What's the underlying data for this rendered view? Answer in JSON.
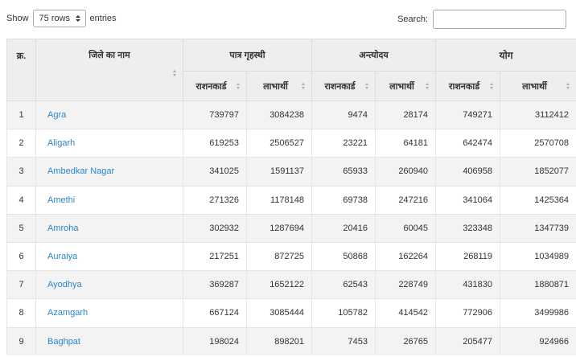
{
  "controls": {
    "show_label": "Show",
    "length_value": "75 rows",
    "entries_label": "entries",
    "search_label": "Search:",
    "search_value": ""
  },
  "table": {
    "headers": {
      "sno": "क्र.",
      "district": "जिले का नाम",
      "group_eligible": "पात्र गृहस्थी",
      "group_antyodaya": "अन्त्योदय",
      "group_total": "योग",
      "sub": [
        "राशनकार्ड",
        "लाभार्थी",
        "राशनकार्ड",
        "लाभार्थी",
        "राशनकार्ड",
        "लाभार्थी"
      ]
    },
    "rows": [
      {
        "sno": "1",
        "district": "Agra",
        "eligible_cards": "739797",
        "eligible_beneficiaries": "3084238",
        "antyodaya_cards": "9474",
        "antyodaya_beneficiaries": "28174",
        "total_cards": "749271",
        "total_beneficiaries": "3112412"
      },
      {
        "sno": "2",
        "district": "Aligarh",
        "eligible_cards": "619253",
        "eligible_beneficiaries": "2506527",
        "antyodaya_cards": "23221",
        "antyodaya_beneficiaries": "64181",
        "total_cards": "642474",
        "total_beneficiaries": "2570708"
      },
      {
        "sno": "3",
        "district": "Ambedkar Nagar",
        "eligible_cards": "341025",
        "eligible_beneficiaries": "1591137",
        "antyodaya_cards": "65933",
        "antyodaya_beneficiaries": "260940",
        "total_cards": "406958",
        "total_beneficiaries": "1852077"
      },
      {
        "sno": "4",
        "district": "Amethi",
        "eligible_cards": "271326",
        "eligible_beneficiaries": "1178148",
        "antyodaya_cards": "69738",
        "antyodaya_beneficiaries": "247216",
        "total_cards": "341064",
        "total_beneficiaries": "1425364"
      },
      {
        "sno": "5",
        "district": "Amroha",
        "eligible_cards": "302932",
        "eligible_beneficiaries": "1287694",
        "antyodaya_cards": "20416",
        "antyodaya_beneficiaries": "60045",
        "total_cards": "323348",
        "total_beneficiaries": "1347739"
      },
      {
        "sno": "6",
        "district": "Auraiya",
        "eligible_cards": "217251",
        "eligible_beneficiaries": "872725",
        "antyodaya_cards": "50868",
        "antyodaya_beneficiaries": "162264",
        "total_cards": "268119",
        "total_beneficiaries": "1034989"
      },
      {
        "sno": "7",
        "district": "Ayodhya",
        "eligible_cards": "369287",
        "eligible_beneficiaries": "1652122",
        "antyodaya_cards": "62543",
        "antyodaya_beneficiaries": "228749",
        "total_cards": "431830",
        "total_beneficiaries": "1880871"
      },
      {
        "sno": "8",
        "district": "Azamgarh",
        "eligible_cards": "667124",
        "eligible_beneficiaries": "3085444",
        "antyodaya_cards": "105782",
        "antyodaya_beneficiaries": "414542",
        "total_cards": "772906",
        "total_beneficiaries": "3499986"
      },
      {
        "sno": "9",
        "district": "Baghpat",
        "eligible_cards": "198024",
        "eligible_beneficiaries": "898201",
        "antyodaya_cards": "7453",
        "antyodaya_beneficiaries": "26765",
        "total_cards": "205477",
        "total_beneficiaries": "924966"
      }
    ]
  },
  "colors": {
    "link": "#2a86c9",
    "header_bg": "#eeeeee",
    "stripe": "#f3f3f3"
  }
}
